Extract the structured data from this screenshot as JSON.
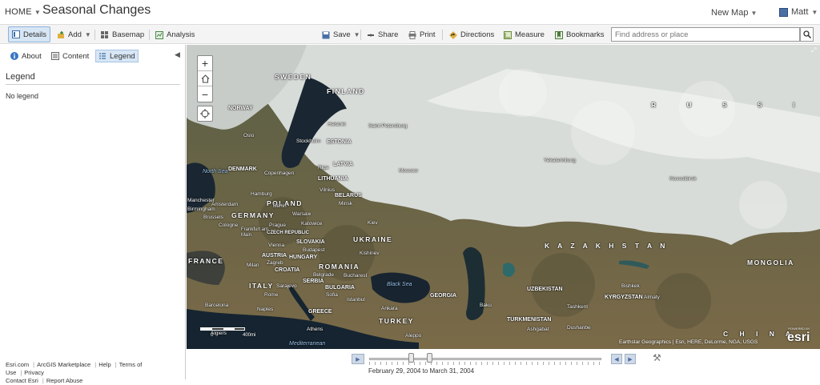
{
  "header": {
    "home": "HOME",
    "title": "Seasonal Changes",
    "new_map": "New Map",
    "user": "Matt"
  },
  "toolbar": {
    "details": "Details",
    "add": "Add",
    "basemap": "Basemap",
    "analysis": "Analysis",
    "save": "Save",
    "share": "Share",
    "print": "Print",
    "directions": "Directions",
    "measure": "Measure",
    "bookmarks": "Bookmarks",
    "search_placeholder": "Find address or place"
  },
  "sidebar": {
    "tabs": [
      {
        "label": "About"
      },
      {
        "label": "Content"
      },
      {
        "label": "Legend"
      }
    ],
    "active_tab": "Legend",
    "heading": "Legend",
    "empty_text": "No legend",
    "footer_links": [
      "Esri.com",
      "ArcGIS Marketplace",
      "Help",
      "Terms of Use",
      "Privacy",
      "Contact Esri",
      "Report Abuse"
    ]
  },
  "map": {
    "labels": {
      "sweden": "SWEDEN",
      "finland": "FINLAND",
      "norway": "NORWAY",
      "russia": "R U S S I A",
      "denmark": "DENMARK",
      "poland": "POLAND",
      "germany": "GERMANY",
      "belarus": "BELARUS",
      "ukraine": "UKRAINE",
      "france": "FRANCE",
      "romania": "ROMANIA",
      "italy": "ITALY",
      "turkey": "TURKEY",
      "kazakhstan": "K A Z A K H S T A N",
      "mongolia": "MONGOLIA",
      "uzbekistan": "UZBEKISTAN",
      "turkmenistan": "TURKMENISTAN",
      "china": "C H I N A",
      "north_sea": "North Sea",
      "black_sea": "Black Sea",
      "mediterranean": "Mediterranean",
      "greece": "GREECE",
      "kyrgyzstan": "KYRGYZSTAN",
      "estonia": "ESTONIA",
      "latvia": "LATVIA",
      "lithuania": "LITHUANIA",
      "georgia": "GEORGIA",
      "hungary": "HUNGARY",
      "slovakia": "SLOVAKIA",
      "serbia": "SERBIA",
      "bulgaria": "BULGARIA",
      "croatia": "CROATIA",
      "austria": "AUSTRIA",
      "czech": "CZECH REPUBLIC"
    },
    "cities": {
      "helsinki": "Helsinki",
      "st_petersburg": "Saint Petersburg",
      "stockholm": "Stockholm",
      "oslo": "Oslo",
      "riga": "Riga",
      "moscow": "Moscow",
      "yekaterinburg": "Yekaterinburg",
      "novosibirsk": "Novosibirsk",
      "copenhagen": "Copenhagen",
      "hamburg": "Hamburg",
      "berlin": "Berlin",
      "amsterdam": "Amsterdam",
      "warsaw": "Warsaw",
      "minsk": "Minsk",
      "vilnius": "Vilnius",
      "kiev": "Kiev",
      "prague": "Prague",
      "frankfurt": "Frankfurt am Main",
      "brussels": "Brussels",
      "cologne": "Cologne",
      "katowice": "Katowice",
      "vienna": "Vienna",
      "budapest": "Budapest",
      "kishinev": "Kishinev",
      "zagreb": "Zagreb",
      "milan": "Milan",
      "belgrade": "Belgrade",
      "bucharest": "Bucharest",
      "sarajevo": "Sarajevo",
      "sofia": "Sofia",
      "istanbul": "Istanbul",
      "rome": "Rome",
      "naples": "Naples",
      "barcelona": "Barcelona",
      "ankara": "Ankara",
      "athens": "Athens",
      "aleppo": "Aleppo",
      "baku": "Baku",
      "tashkent": "Tashkent",
      "bishkek": "Bishkek",
      "almaty": "Almaty",
      "dushanbe": "Dushanbe",
      "ashgabat": "Ashgabat",
      "manchester": "Manchester",
      "birmingham": "Birmingham",
      "algiers": "Algiers"
    },
    "attribution": "Earthstar Geographics | Esri, HERE, DeLorme, NGA, USGS",
    "logo": "esri",
    "logo_caption": "POWERED BY",
    "scale_left": "0",
    "scale_right": "400mi"
  },
  "time_slider": {
    "range_text": "February 29, 2004 to March 31, 2004"
  }
}
